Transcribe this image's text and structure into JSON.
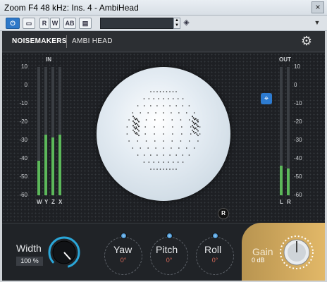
{
  "window": {
    "title": "Zoom F4 48 kHz: Ins. 4 - AmbiHead",
    "close": "×"
  },
  "toolbar": {
    "power": "⏻",
    "compare": "▭",
    "read": "R",
    "write": "W",
    "ab": "AB",
    "settings": "▤",
    "spin_up": "▲",
    "spin_down": "▼",
    "preset_menu": "◈",
    "window_menu": "▼"
  },
  "header": {
    "brand": "NOISEMAKERS",
    "product": "AMBI HEAD"
  },
  "meters": {
    "in_title": "IN",
    "out_title": "OUT",
    "scale": [
      "10",
      "0",
      "-10",
      "-20",
      "-30",
      "-40",
      "-50",
      "-60"
    ],
    "in_channels": [
      {
        "label": "W",
        "level": 0.27
      },
      {
        "label": "Y",
        "level": 0.47
      },
      {
        "label": "Z",
        "level": 0.45
      },
      {
        "label": "X",
        "level": 0.47
      }
    ],
    "out_channels": [
      {
        "label": "L",
        "level": 0.23
      },
      {
        "label": "R",
        "level": 0.21
      }
    ]
  },
  "visual": {
    "r_badge": "R",
    "link_icon": "⌖"
  },
  "controls": {
    "width": {
      "label": "Width",
      "value": "100 %"
    },
    "yaw": {
      "label": "Yaw",
      "value": "0°"
    },
    "pitch": {
      "label": "Pitch",
      "value": "0°"
    },
    "roll": {
      "label": "Roll",
      "value": "0°"
    },
    "gain": {
      "label": "Gain",
      "value": "0 dB"
    }
  },
  "colors": {
    "meter_green": "#5cb85a",
    "accent_blue": "#2d7bd0",
    "gain_gold": "#d6ab5c",
    "value_red": "#d86a5a"
  }
}
